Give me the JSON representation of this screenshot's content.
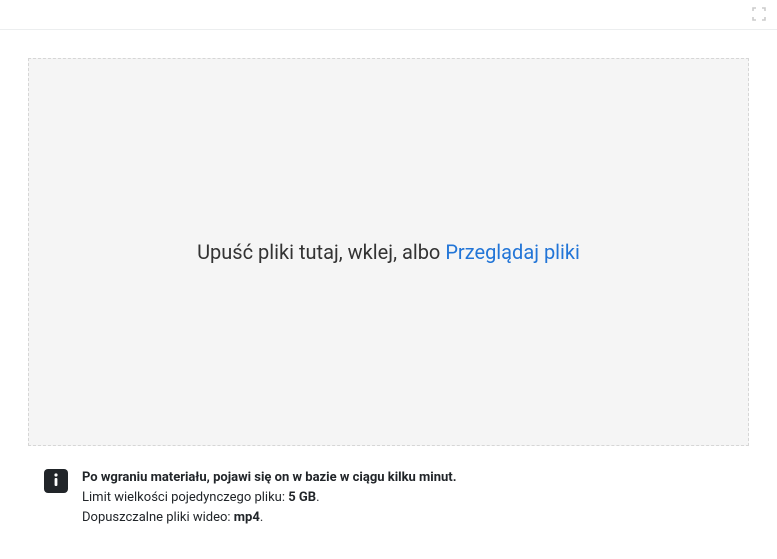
{
  "dropzone": {
    "prompt_prefix": "Upuść pliki tutaj, wklej, albo ",
    "browse_label": "Przeglądaj pliki"
  },
  "info": {
    "line1": "Po wgraniu materiału, pojawi się on w bazie w ciągu kilku minut.",
    "line2_prefix": "Limit wielkości pojedynczego pliku: ",
    "line2_value": "5 GB",
    "line2_suffix": ".",
    "line3_prefix": "Dopuszczalne pliki wideo: ",
    "line3_value": "mp4",
    "line3_suffix": "."
  }
}
